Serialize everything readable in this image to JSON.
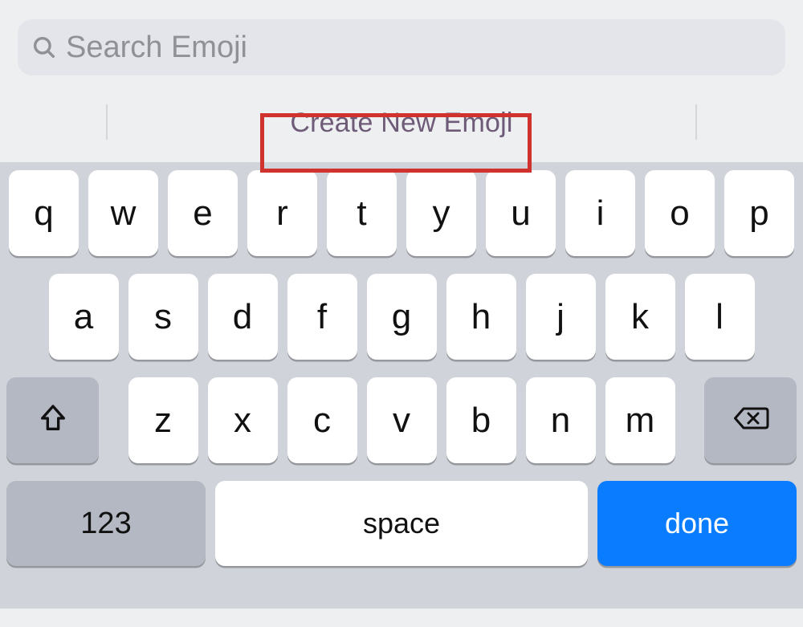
{
  "search": {
    "placeholder": "Search Emoji"
  },
  "suggest": {
    "create_label": "Create New Emoji"
  },
  "keyboard": {
    "row1": [
      "q",
      "w",
      "e",
      "r",
      "t",
      "y",
      "u",
      "i",
      "o",
      "p"
    ],
    "row2": [
      "a",
      "s",
      "d",
      "f",
      "g",
      "h",
      "j",
      "k",
      "l"
    ],
    "row3": [
      "z",
      "x",
      "c",
      "v",
      "b",
      "n",
      "m"
    ],
    "numeric_label": "123",
    "space_label": "space",
    "done_label": "done"
  }
}
